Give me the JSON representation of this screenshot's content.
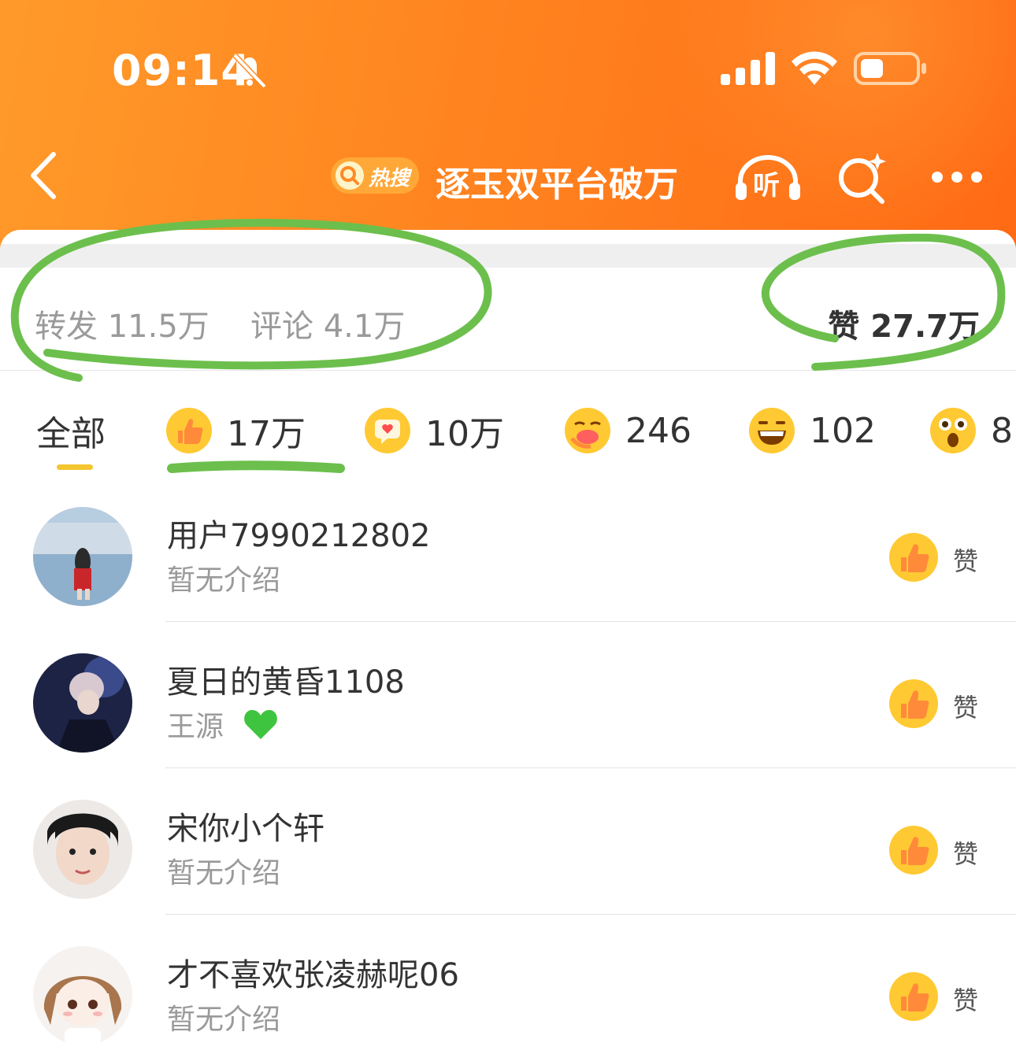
{
  "status_bar": {
    "time": "09:14"
  },
  "header": {
    "hot_badge": "热搜",
    "title": "逐玉双平台破万",
    "listen_label": "听"
  },
  "stats": {
    "repost": "转发 11.5万",
    "comment": "评论 4.1万",
    "like": "赞 27.7万"
  },
  "tabs": [
    {
      "label": "全部",
      "active": true
    },
    {
      "label": "17万",
      "icon": "thumbs-up-emoji"
    },
    {
      "label": "10万",
      "icon": "heart-bubble-emoji"
    },
    {
      "label": "246",
      "icon": "blush-emoji"
    },
    {
      "label": "102",
      "icon": "grin-emoji"
    },
    {
      "label": "8",
      "icon": "surprised-emoji"
    }
  ],
  "users": [
    {
      "name": "用户7990212802",
      "desc": "暂无介绍",
      "like_label": "赞"
    },
    {
      "name": "夏日的黄昏1108",
      "desc": "王源",
      "like_label": "赞",
      "badge_icon": "green-heart-icon"
    },
    {
      "name": "宋你小个轩",
      "desc": "暂无介绍",
      "like_label": "赞"
    },
    {
      "name": "才不喜欢张凌赫呢06",
      "desc": "暂无介绍",
      "like_label": "赞"
    }
  ],
  "colors": {
    "header_orange": "#ff8420",
    "annotation_green": "#6cbf4c",
    "tab_indicator": "#f4c530"
  }
}
